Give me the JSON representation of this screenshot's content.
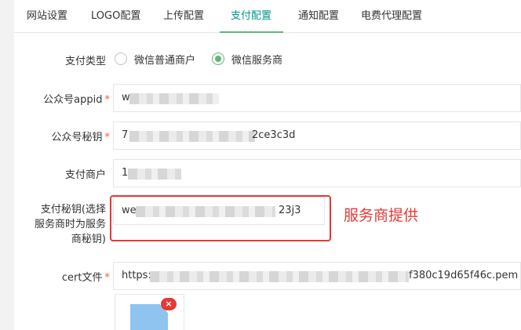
{
  "tabs": [
    {
      "label": "网站设置"
    },
    {
      "label": "LOGO配置"
    },
    {
      "label": "上传配置"
    },
    {
      "label": "支付配置"
    },
    {
      "label": "通知配置"
    },
    {
      "label": "电费代理配置"
    }
  ],
  "form": {
    "payment_type": {
      "label": "支付类型",
      "options": [
        "微信普通商户",
        "微信服务商"
      ],
      "selected": "微信服务商"
    },
    "appid": {
      "label": "公众号appid",
      "required_mark": "*",
      "value_prefix": "w"
    },
    "secret": {
      "label": "公众号秘钥",
      "required_mark": "*",
      "value_prefix": "7",
      "value_suffix": "2ce3c3d"
    },
    "merchant": {
      "label": "支付商户",
      "value_prefix": "1"
    },
    "pay_secret": {
      "label_lines": [
        "支付秘钥(选择",
        "服务商时为服务",
        "商秘钥)"
      ],
      "value_prefix": "we",
      "value_suffix": "23j3"
    },
    "cert_file": {
      "label": "cert文件",
      "required_mark": "*",
      "value_prefix": "https:",
      "value_suffix": "f380c19d65f46c.pem"
    }
  },
  "annotation": {
    "text": "服务商提供",
    "color": "#e53935"
  },
  "upload": {
    "delete_glyph": "×"
  },
  "colors": {
    "accent": "#009688",
    "radio_checked": "#5FB878",
    "required": "#ff5722",
    "annotation": "#e53935"
  }
}
